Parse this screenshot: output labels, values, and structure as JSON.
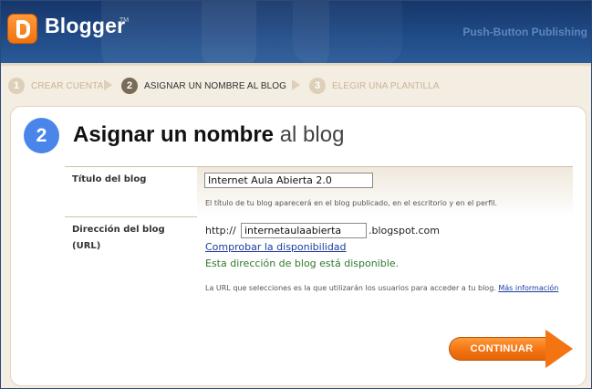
{
  "header": {
    "logo_text": "Blogger",
    "logo_tm": "TM",
    "tagline": "Push-Button Publishing"
  },
  "steps": [
    {
      "number": "1",
      "label": "CREAR CUENTA",
      "active": false
    },
    {
      "number": "2",
      "label": "ASIGNAR UN NOMBRE AL BLOG",
      "active": true
    },
    {
      "number": "3",
      "label": "ELEGIR UNA PLANTILLA",
      "active": false
    }
  ],
  "page": {
    "step_number": "2",
    "title_bold": "Asignar un nombre",
    "title_light": "al blog"
  },
  "form": {
    "blog_title": {
      "label": "Título del blog",
      "value": "Internet Aula Abierta 2.0",
      "hint": "El título de tu blog aparecerá en el blog publicado, en el escritorio y en el perfil."
    },
    "blog_address": {
      "label_line1": "Dirección del blog",
      "label_line2": "(URL)",
      "prefix": "http://",
      "value": "internetaulaabierta",
      "suffix": ".blogspot.com",
      "check_link": "Comprobar la disponibilidad",
      "available_msg": "Esta dirección de blog está disponible.",
      "hint": "La URL que selecciones es la que utilizarán los usuarios para acceder a tu blog.",
      "more_info_link": "Más información"
    }
  },
  "actions": {
    "continue_label": "CONTINUAR"
  },
  "colors": {
    "header_blue": "#1f4a86",
    "accent_orange": "#f47412",
    "step_blue": "#4a86ea",
    "available_green": "#2f7a2a",
    "link_blue": "#1a3c9c"
  }
}
